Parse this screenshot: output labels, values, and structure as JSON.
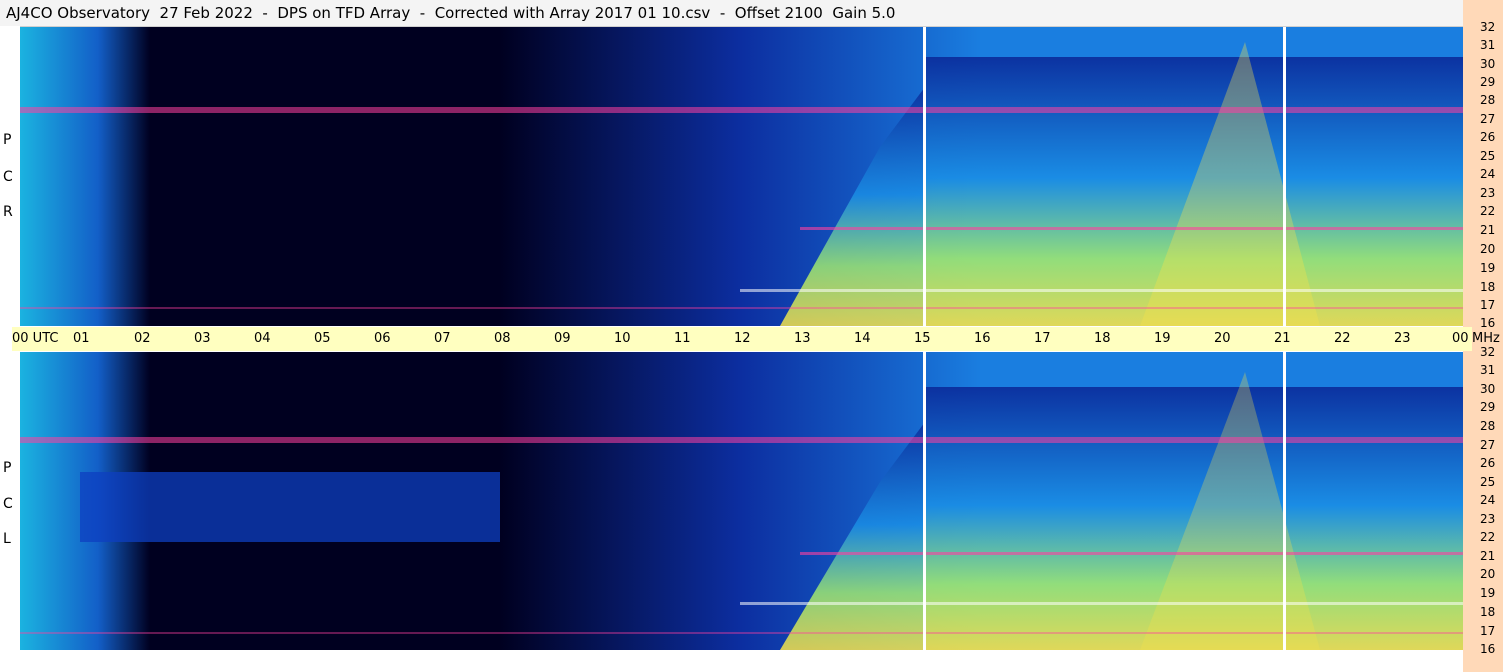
{
  "title": "AJ4CO Observatory  27 Feb 2022  -  DPS on TFD Array  -  Corrected with Array 2017 01 10.csv  -  Offset 2100  Gain 5.0",
  "panels": [
    {
      "id": "rcp",
      "letters": [
        "R",
        "C",
        "P"
      ]
    },
    {
      "id": "lcp",
      "letters": [
        "L",
        "C",
        "P"
      ]
    }
  ],
  "time_axis": {
    "labels": [
      "00  UTC",
      "01",
      "02",
      "03",
      "04",
      "05",
      "06",
      "07",
      "08",
      "09",
      "10",
      "11",
      "12",
      "13",
      "14",
      "15",
      "16",
      "17",
      "18",
      "19",
      "20",
      "21",
      "22",
      "23",
      "00"
    ],
    "unit": "MHz"
  },
  "freq_axis": {
    "labels": [
      "32",
      "31",
      "30",
      "29",
      "28",
      "27",
      "26",
      "25",
      "24",
      "23",
      "22",
      "21",
      "20",
      "19",
      "18",
      "17",
      "16"
    ]
  },
  "colors": {
    "background": "#000020",
    "low": "#0a1a8a",
    "mid": "#1e88e5",
    "high": "#7fe88a",
    "peak": "#f2e44a",
    "hot": "#ff3fa0"
  }
}
